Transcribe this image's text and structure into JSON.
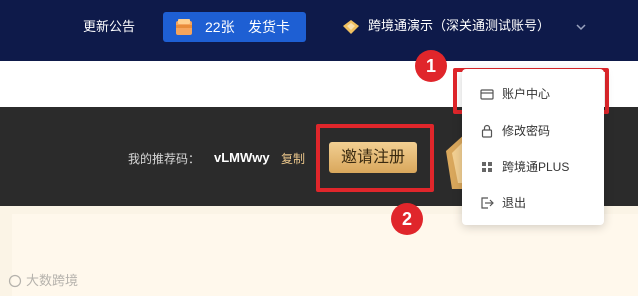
{
  "header": {
    "notice_label": "更新公告",
    "card_count": "22张",
    "card_action": "发货卡",
    "account_name": "跨境通演示（深关通测试账号）"
  },
  "banner": {
    "referral_label": "我的推荐码：",
    "referral_code": "vLMWwy",
    "copy_label": "复制",
    "invite_button": "邀请注册"
  },
  "dropdown": {
    "items": [
      {
        "label": "账户中心",
        "icon": "card-icon"
      },
      {
        "label": "修改密码",
        "icon": "lock-icon"
      },
      {
        "label": "跨境通PLUS",
        "icon": "grid-icon"
      },
      {
        "label": "退出",
        "icon": "logout-icon"
      }
    ]
  },
  "annotations": {
    "badge_1": "1",
    "badge_2": "2"
  },
  "watermark": "大数跨境",
  "colors": {
    "topbar": "#0e1a4a",
    "pill": "#1e5fd3",
    "highlight": "#e0262b",
    "gold": "#d9a75c"
  }
}
